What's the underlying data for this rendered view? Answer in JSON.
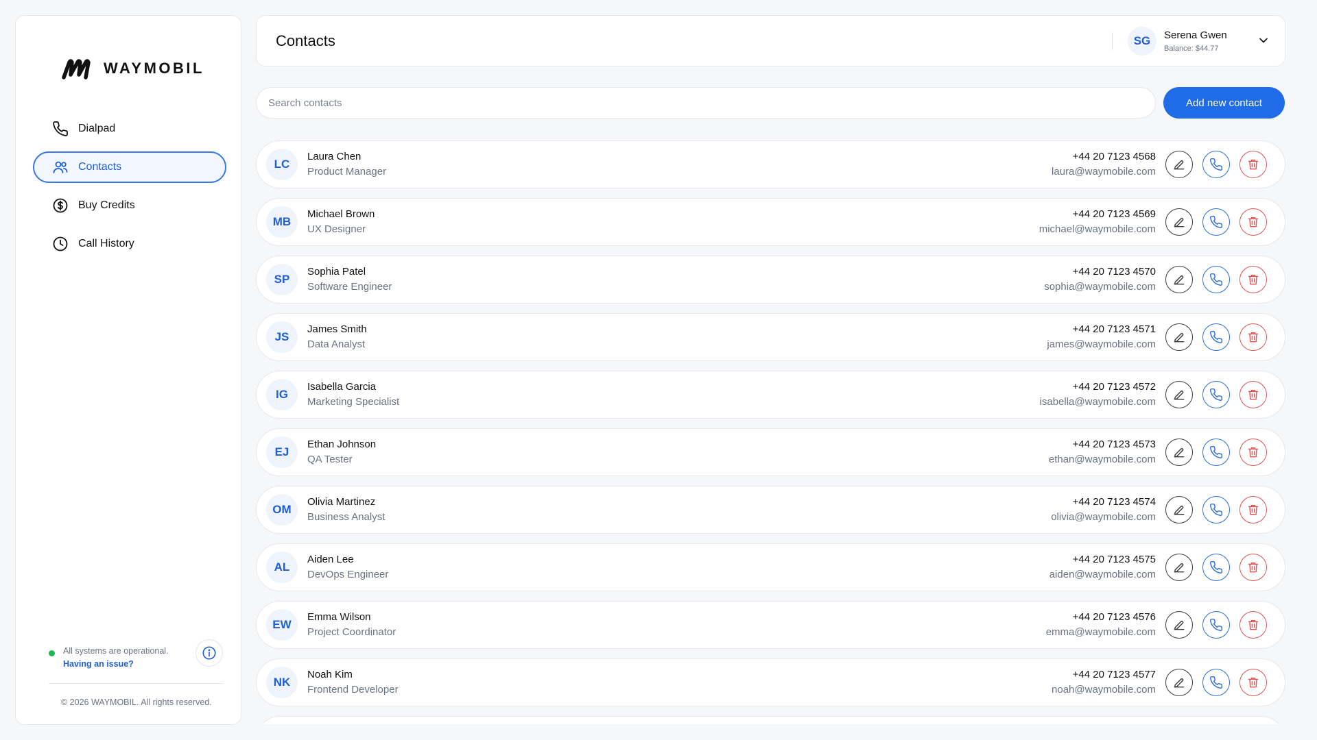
{
  "brand": {
    "name": "WAYMOBIL",
    "copyright": "© 2026 WAYMOBIL. All rights reserved."
  },
  "nav": [
    {
      "label": "Dialpad",
      "icon": "phone-icon",
      "active": false
    },
    {
      "label": "Contacts",
      "icon": "users-icon",
      "active": true
    },
    {
      "label": "Buy Credits",
      "icon": "dollar-circle-icon",
      "active": false
    },
    {
      "label": "Call History",
      "icon": "clock-icon",
      "active": false
    }
  ],
  "status": {
    "text": "All systems are operational.",
    "link": "Having an issue?"
  },
  "header": {
    "title": "Contacts",
    "user": {
      "initials": "SG",
      "name": "Serena Gwen",
      "balance": "Balance: $44.77"
    }
  },
  "search": {
    "placeholder": "Search contacts",
    "value": ""
  },
  "add_button": "Add new contact",
  "contacts": [
    {
      "initials": "LC",
      "name": "Laura Chen",
      "role": "Product Manager",
      "phone": "+44 20 7123 4568",
      "email": "laura@waymobile.com"
    },
    {
      "initials": "MB",
      "name": "Michael Brown",
      "role": "UX Designer",
      "phone": "+44 20 7123 4569",
      "email": "michael@waymobile.com"
    },
    {
      "initials": "SP",
      "name": "Sophia Patel",
      "role": "Software Engineer",
      "phone": "+44 20 7123 4570",
      "email": "sophia@waymobile.com"
    },
    {
      "initials": "JS",
      "name": "James Smith",
      "role": "Data Analyst",
      "phone": "+44 20 7123 4571",
      "email": "james@waymobile.com"
    },
    {
      "initials": "IG",
      "name": "Isabella Garcia",
      "role": "Marketing Specialist",
      "phone": "+44 20 7123 4572",
      "email": "isabella@waymobile.com"
    },
    {
      "initials": "EJ",
      "name": "Ethan Johnson",
      "role": "QA Tester",
      "phone": "+44 20 7123 4573",
      "email": "ethan@waymobile.com"
    },
    {
      "initials": "OM",
      "name": "Olivia Martinez",
      "role": "Business Analyst",
      "phone": "+44 20 7123 4574",
      "email": "olivia@waymobile.com"
    },
    {
      "initials": "AL",
      "name": "Aiden Lee",
      "role": "DevOps Engineer",
      "phone": "+44 20 7123 4575",
      "email": "aiden@waymobile.com"
    },
    {
      "initials": "EW",
      "name": "Emma Wilson",
      "role": "Project Coordinator",
      "phone": "+44 20 7123 4576",
      "email": "emma@waymobile.com"
    },
    {
      "initials": "NK",
      "name": "Noah Kim",
      "role": "Frontend Developer",
      "phone": "+44 20 7123 4577",
      "email": "noah@waymobile.com"
    }
  ],
  "colors": {
    "accent": "#1f6be8",
    "success": "#1db954",
    "danger": "#e25252"
  }
}
